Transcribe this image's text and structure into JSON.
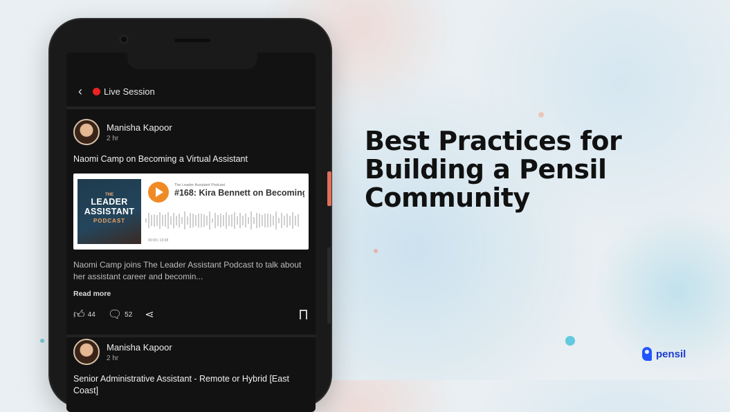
{
  "headline": {
    "line1": "Best Practices for",
    "line2": "Building a Pensil",
    "line3": "Community"
  },
  "brand": {
    "name": "pensil",
    "color": "#1d3bd0"
  },
  "app": {
    "top_bar": {
      "title": "Live Session",
      "back_icon": "chevron-left-icon"
    },
    "posts": [
      {
        "author": "Manisha Kapoor",
        "time": "2 hr",
        "title": "Naomi Camp on Becoming a Virtual Assistant",
        "embed": {
          "cover_line1": "THE",
          "cover_line2": "LEADER",
          "cover_line3": "ASSISTANT",
          "cover_line4": "PODCAST",
          "show_name": "The Leader Assistant Podcast",
          "episode_title": "#168: Kira Bennett on Becoming",
          "time": "00:00 | 13:38"
        },
        "body": "Naomi Camp joins The Leader Assistant Podcast to talk about her assistant career and becomin...",
        "read_more": "Read more",
        "likes": "44",
        "comments": "52"
      },
      {
        "author": "Manisha Kapoor",
        "time": "2 hr",
        "title": "Senior Administrative Assistant - Remote or Hybrid [East Coast]"
      }
    ]
  }
}
